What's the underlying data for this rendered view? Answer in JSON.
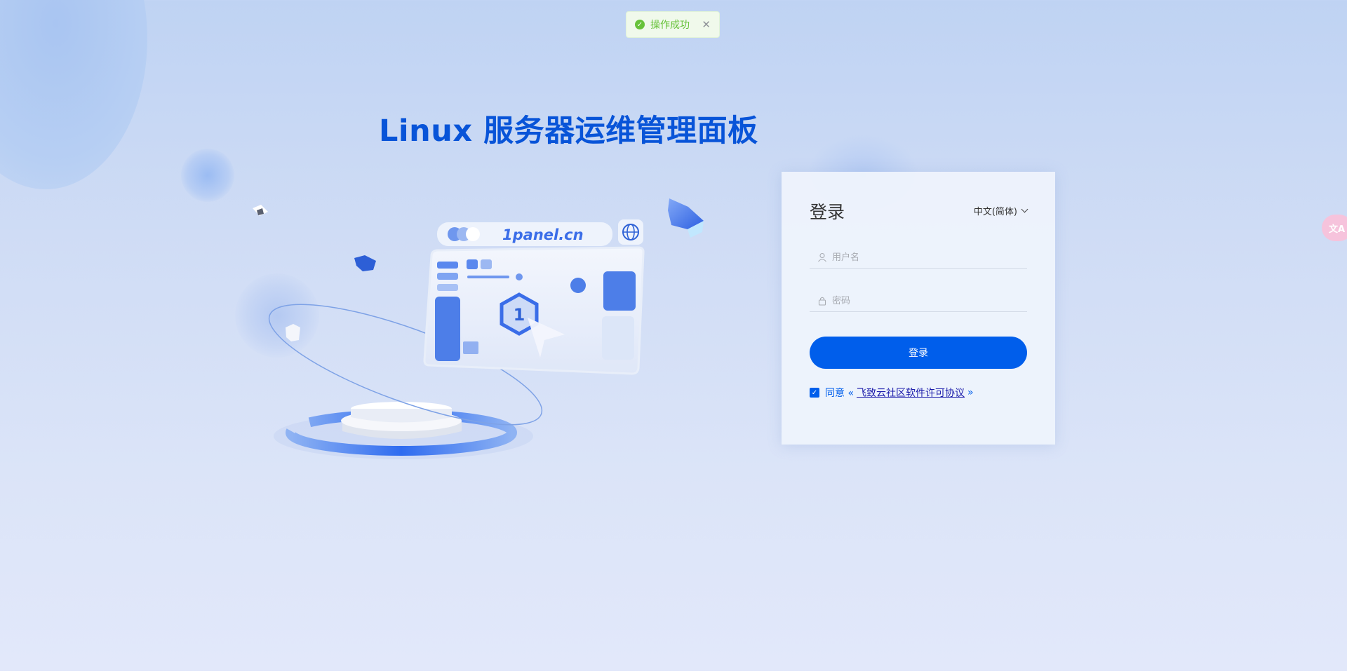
{
  "toast": {
    "message": "操作成功",
    "status_icon": "success-check-icon",
    "close_icon": "close-icon"
  },
  "headline": "Linux 服务器运维管理面板",
  "illustration": {
    "domain_label": "1panel.cn",
    "logo_glyph": "1"
  },
  "login": {
    "title": "登录",
    "language": "中文(简体)",
    "username_placeholder": "用户名",
    "password_placeholder": "密码",
    "submit_label": "登录",
    "agree_prefix": "同意 «",
    "agreement_link": "飞致云社区软件许可协议",
    "agree_suffix": "»",
    "agree_checked": true
  },
  "translate_button": {
    "icon": "translate-icon",
    "glyph": "文A"
  },
  "colors": {
    "primary": "#005eeb",
    "headline": "#0854d8",
    "success": "#67c23a"
  }
}
